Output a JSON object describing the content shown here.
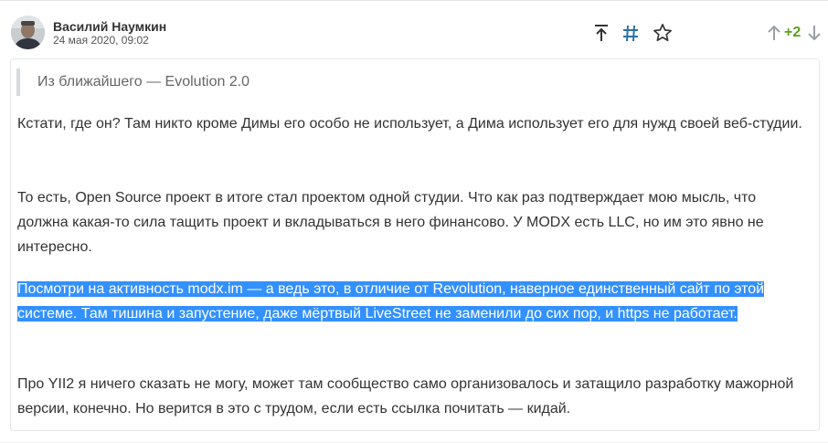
{
  "comment": {
    "author": "Василий Наумкин",
    "date": "24 мая 2020, 09:02",
    "score": "+2",
    "quote": "Из ближайшего — Evolution 2.0",
    "paragraphs": [
      "Кстати, где он? Там никто кроме Димы его особо не использует, а Дима использует его для нужд своей веб-студии.",
      "То есть, Open Source проект в итоге стал проектом одной студии. Что как раз подтверждает мою мысль, что должна какая-то сила тащить проект и вкладываться в него финансово. У MODX есть LLC, но им это явно не интересно.",
      "Посмотри на активность modx.im — а ведь это, в отличие от Revolution, наверное единственный сайт по этой системе. Там тишина и запустение, даже мёртвый LiveStreet не заменили до сих пор, и https не работает.",
      "Про YII2 я ничего сказать не могу, может там сообщество само организовалось и затащило разработку мажорной версии, конечно. Но верится в это с трудом, если есть ссылка почитать — кидай."
    ]
  },
  "icons": {
    "go_parent": "arrow-to-top-icon",
    "permalink": "hash-icon",
    "favorite": "star-icon",
    "vote_up": "arrow-up-icon",
    "vote_down": "arrow-down-icon"
  },
  "colors": {
    "score": "#5c9f1d",
    "selection": "#3390ff",
    "hash_icon": "#2e6fa6"
  }
}
